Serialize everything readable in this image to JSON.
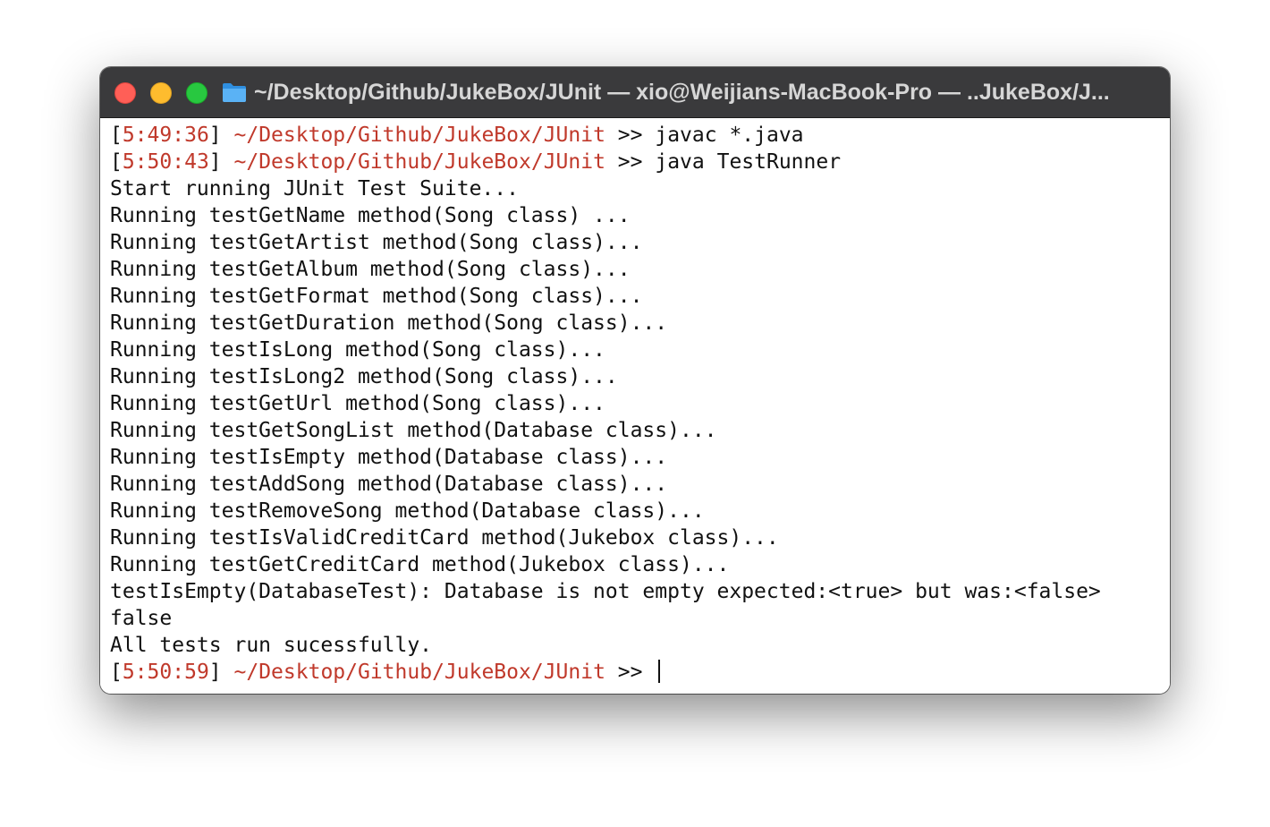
{
  "window": {
    "title": "~/Desktop/Github/JukeBox/JUnit — xio@Weijians-MacBook-Pro — ..JukeBox/J...",
    "title_icon": "folder-icon",
    "colors": {
      "titlebar": "#3a3a3c",
      "close": "#ff5f57",
      "minimize": "#febc2e",
      "maximize": "#28c840",
      "prompt_accent": "#c0392b"
    }
  },
  "terminal": {
    "prompts": [
      {
        "bracket_open": "[",
        "time": "5:49:36",
        "bracket_close": "]",
        "path": "~/Desktop/Github/JukeBox/JUnit",
        "arrows": ">>",
        "command": "javac *.java"
      },
      {
        "bracket_open": "[",
        "time": "5:50:43",
        "bracket_close": "]",
        "path": "~/Desktop/Github/JukeBox/JUnit",
        "arrows": ">>",
        "command": "java TestRunner"
      }
    ],
    "output": [
      "Start running JUnit Test Suite...",
      "Running testGetName method(Song class) ...",
      "Running testGetArtist method(Song class)...",
      "Running testGetAlbum method(Song class)...",
      "Running testGetFormat method(Song class)...",
      "Running testGetDuration method(Song class)...",
      "Running testIsLong method(Song class)...",
      "Running testIsLong2 method(Song class)...",
      "Running testGetUrl method(Song class)...",
      "Running testGetSongList method(Database class)...",
      "Running testIsEmpty method(Database class)...",
      "Running testAddSong method(Database class)...",
      "Running testRemoveSong method(Database class)...",
      "Running testIsValidCreditCard method(Jukebox class)...",
      "Running testGetCreditCard method(Jukebox class)...",
      "testIsEmpty(DatabaseTest): Database is not empty expected:<true> but was:<false>",
      "false",
      "All tests run sucessfully."
    ],
    "final_prompt": {
      "bracket_open": "[",
      "time": "5:50:59",
      "bracket_close": "]",
      "path": "~/Desktop/Github/JukeBox/JUnit",
      "arrows": ">>",
      "command": ""
    }
  }
}
